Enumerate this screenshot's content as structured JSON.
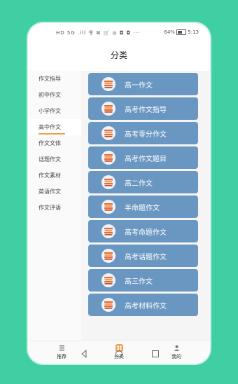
{
  "colors": {
    "background": "#3fcfa3",
    "button": "#6a97c2",
    "accent": "#f0a050"
  },
  "status_bar": {
    "left_icons": "HD 5G .ill 令 ⊠ 🛒 ◎ ◘ ◘ ···",
    "battery": "64%",
    "time": "5:13"
  },
  "header": {
    "title": "分类"
  },
  "sidebar": {
    "items": [
      {
        "label": "作文指导"
      },
      {
        "label": "初中作文"
      },
      {
        "label": "小学作文"
      },
      {
        "label": "高中作文",
        "active": true
      },
      {
        "label": "作文文体"
      },
      {
        "label": "话题作文"
      },
      {
        "label": "作文素材"
      },
      {
        "label": "英语作文"
      },
      {
        "label": "作文评语"
      }
    ]
  },
  "categories": [
    {
      "label": "高一作文",
      "icon": "book-stack-icon"
    },
    {
      "label": "高考作文指导",
      "icon": "book-stack-icon"
    },
    {
      "label": "高考零分作文",
      "icon": "book-stack-icon"
    },
    {
      "label": "高考作文题目",
      "icon": "book-stack-icon"
    },
    {
      "label": "高二作文",
      "icon": "book-stack-icon"
    },
    {
      "label": "半命题作文",
      "icon": "book-stack-icon"
    },
    {
      "label": "高考命题作文",
      "icon": "book-stack-icon"
    },
    {
      "label": "高考话题作文",
      "icon": "book-stack-icon"
    },
    {
      "label": "高三作文",
      "icon": "book-stack-icon"
    },
    {
      "label": "高考材料作文",
      "icon": "book-stack-icon"
    }
  ],
  "tabbar": {
    "recommend": {
      "label": "推荐",
      "icon": "list-icon"
    },
    "category": {
      "label": "分类",
      "icon": "grid-icon",
      "active": true
    },
    "mine": {
      "label": "我的",
      "icon": "person-icon"
    }
  },
  "system_nav": {
    "back": "back-icon",
    "home": "home-icon",
    "recents": "recents-icon"
  }
}
